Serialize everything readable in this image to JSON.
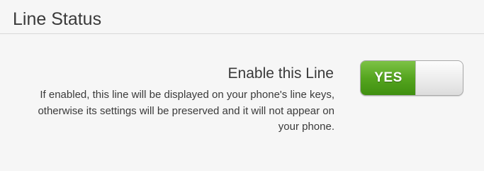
{
  "section": {
    "title": "Line Status"
  },
  "setting": {
    "label": "Enable this Line",
    "help_text": "If enabled, this line will be displayed on your phone's line keys, otherwise its settings will be preserved and it will not appear on your phone.",
    "toggle": {
      "state": "on",
      "on_label": "YES",
      "on_color": "#55a51f"
    }
  }
}
